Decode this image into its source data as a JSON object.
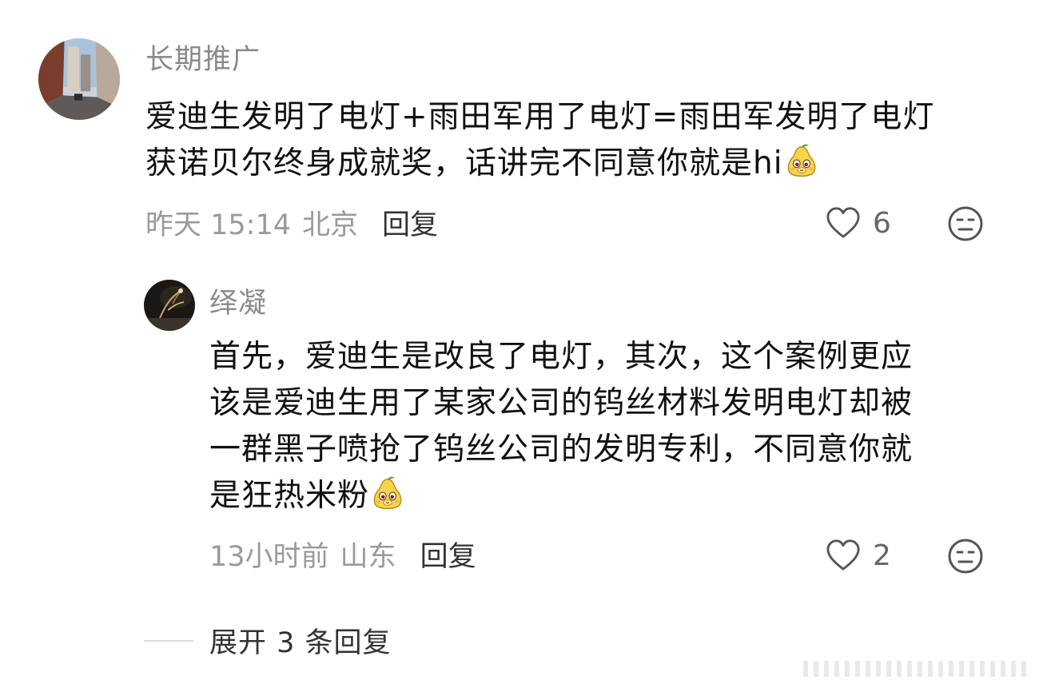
{
  "comment": {
    "username": "长期推广",
    "text_line1": "爱迪生发明了电灯+雨田军用了电灯=雨田军发明了电灯",
    "text_line2": "获诺贝尔终身成就奖，话讲完不同意你就是hi",
    "emoji": "pear-face-emoji",
    "time": "昨天 15:14",
    "location": "北京",
    "reply_label": "回复",
    "like_count": "6"
  },
  "reply": {
    "username": "绎凝",
    "text_line1": "首先，爱迪生是改良了电灯，其次，这个案例更应",
    "text_line2": "该是爱迪生用了某家公司的钨丝材料发明电灯却被",
    "text_line3": "一群黑子喷抢了钨丝公司的发明专利，不同意你就",
    "text_line4": "是狂热米粉",
    "emoji": "pear-face-emoji",
    "time": "13小时前",
    "location": "山东",
    "reply_label": "回复",
    "like_count": "2"
  },
  "expand_label": "展开 3 条回复",
  "icons": [
    "heart-outline-icon",
    "meh-face-icon"
  ],
  "colors": {
    "meta": "#9a9a9a",
    "name": "#8a8a8a",
    "text": "#111111",
    "icon": "#666666"
  }
}
